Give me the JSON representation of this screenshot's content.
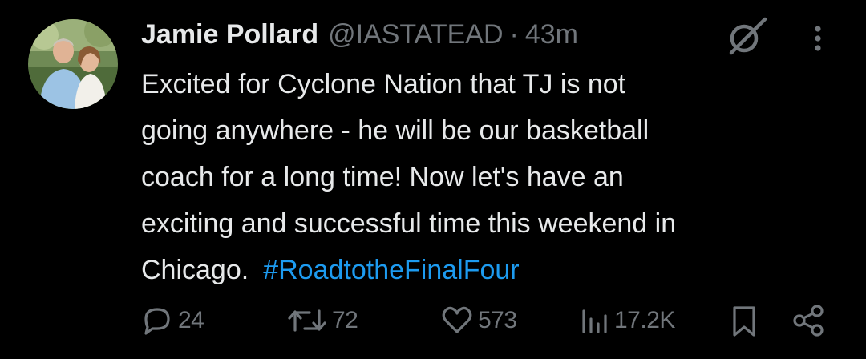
{
  "author": {
    "name": "Jamie Pollard",
    "handle": "@IASTATEAD",
    "separator": "·",
    "time": "43m"
  },
  "tweet": {
    "lines": [
      "Excited for Cyclone Nation that TJ is not",
      "going anywhere - he will be our basketball",
      "coach for a long time!  Now let's have an",
      "exciting and successful time this weekend in",
      "Chicago."
    ],
    "hashtag": "#RoadtotheFinalFour"
  },
  "actions": {
    "replies": "24",
    "reposts": "72",
    "likes": "573",
    "views": "17.2K"
  },
  "icons": {
    "avatar": "profile-photo",
    "grok": "grok-icon",
    "more": "more-dots-icon",
    "reply": "reply-bubble-icon",
    "repost": "repost-arrows-icon",
    "like": "heart-icon",
    "views": "bar-chart-icon",
    "bookmark": "bookmark-icon",
    "share": "share-icon"
  },
  "colors": {
    "background": "#000000",
    "text": "#e7e9ea",
    "muted": "#71767b",
    "link": "#1d9bf0"
  }
}
